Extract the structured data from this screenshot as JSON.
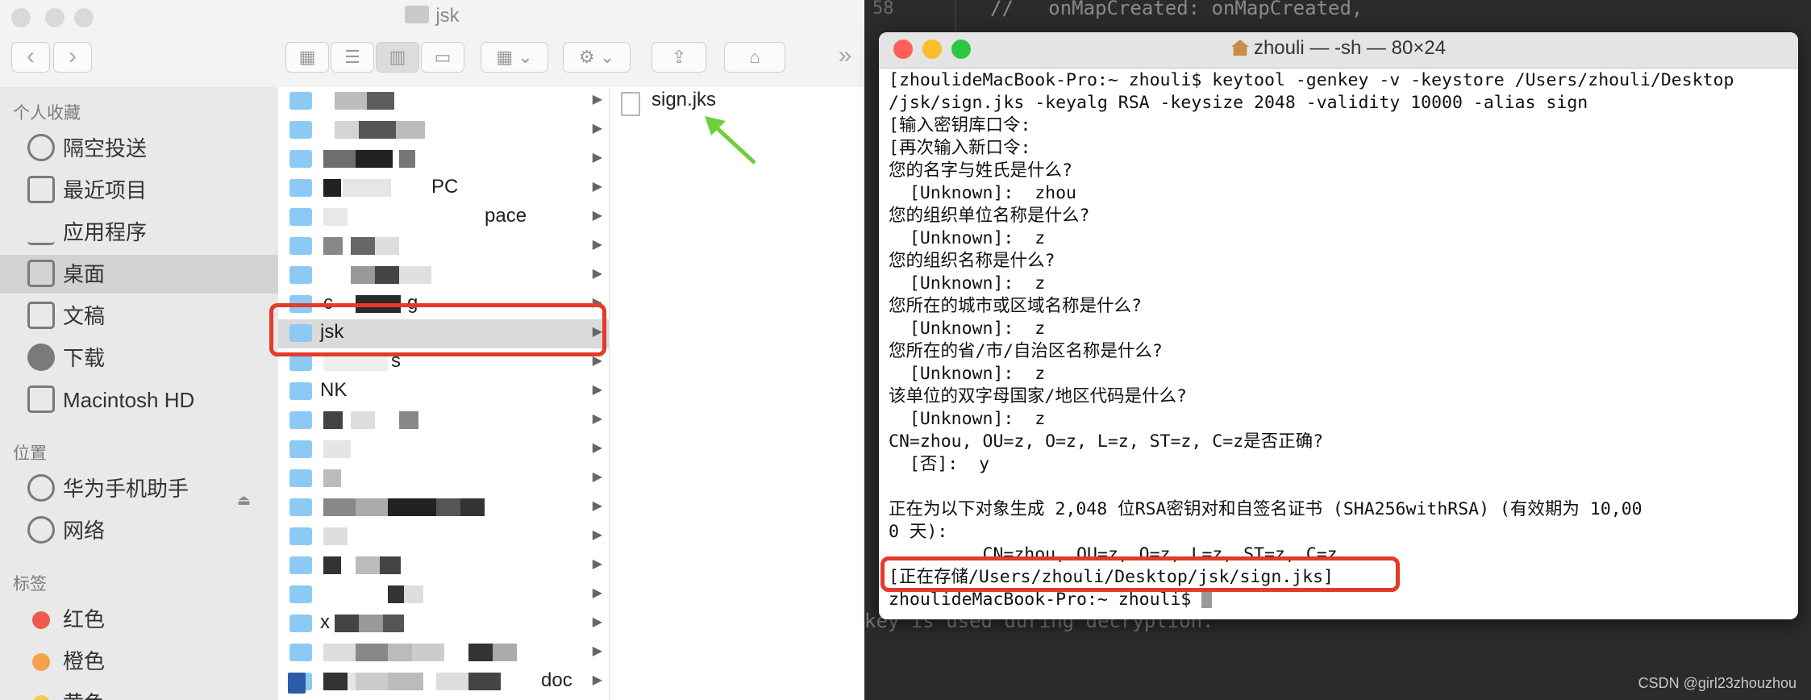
{
  "finder": {
    "title": "jsk",
    "sidebar": {
      "favorites_header": "个人收藏",
      "favorites": [
        {
          "label": "隔空投送",
          "icon": "airdrop-icon"
        },
        {
          "label": "最近项目",
          "icon": "recents-icon"
        },
        {
          "label": "应用程序",
          "icon": "applications-icon"
        },
        {
          "label": "桌面",
          "icon": "desktop-icon",
          "selected": true
        },
        {
          "label": "文稿",
          "icon": "documents-icon"
        },
        {
          "label": "下载",
          "icon": "downloads-icon"
        },
        {
          "label": "Macintosh HD",
          "icon": "disk-icon"
        }
      ],
      "locations_header": "位置",
      "locations": [
        {
          "label": "华为手机助手",
          "icon": "huawei-disk-icon"
        },
        {
          "label": "网络",
          "icon": "network-icon"
        }
      ],
      "tags_header": "标签",
      "tags": [
        {
          "label": "红色",
          "color": "#ef5a4e"
        },
        {
          "label": "橙色",
          "color": "#f4a24a"
        },
        {
          "label": "黄色",
          "color": "#f6cc4c"
        }
      ]
    },
    "column1": {
      "partial_labels": {
        "row5": "PC",
        "row6": "pace",
        "row7": "c",
        "row8": "g",
        "row10": "s",
        "row11": "NK",
        "row18": "x",
        "row21": "doc"
      },
      "selected_folder": "jsk"
    },
    "column2": {
      "file_name": "sign.jks"
    },
    "colors": {
      "selection_box": "#e53a2a",
      "arrow": "#6ecf3a",
      "folder": "#8ccaf5"
    }
  },
  "editor": {
    "line_number": "58",
    "top_code": "//   onMapCreated: onMapCreated,",
    "bottom_code": "key is used during decryption."
  },
  "terminal": {
    "title": "zhouli — -sh — 80×24",
    "lines": [
      "[zhoulideMacBook-Pro:~ zhouli$ keytool -genkey -v -keystore /Users/zhouli/Desktop",
      "/jsk/sign.jks -keyalg RSA -keysize 2048 -validity 10000 -alias sign",
      "[输入密钥库口令:",
      "[再次输入新口令:",
      "您的名字与姓氏是什么?",
      "  [Unknown]:  zhou",
      "您的组织单位名称是什么?",
      "  [Unknown]:  z",
      "您的组织名称是什么?",
      "  [Unknown]:  z",
      "您所在的城市或区域名称是什么?",
      "  [Unknown]:  z",
      "您所在的省/市/自治区名称是什么?",
      "  [Unknown]:  z",
      "该单位的双字母国家/地区代码是什么?",
      "  [Unknown]:  z",
      "CN=zhou, OU=z, O=z, L=z, ST=z, C=z是否正确?",
      "  [否]:  y",
      "",
      "正在为以下对象生成 2,048 位RSA密钥对和自签名证书 (SHA256withRSA) (有效期为 10,00",
      "0 天):",
      "         CN=zhou, OU=z, O=z, L=z, ST=z, C=z",
      "[正在存储/Users/zhouli/Desktop/jsk/sign.jks]",
      "zhoulideMacBook-Pro:~ zhouli$ "
    ]
  },
  "watermark": "CSDN @girl23zhouzhou"
}
